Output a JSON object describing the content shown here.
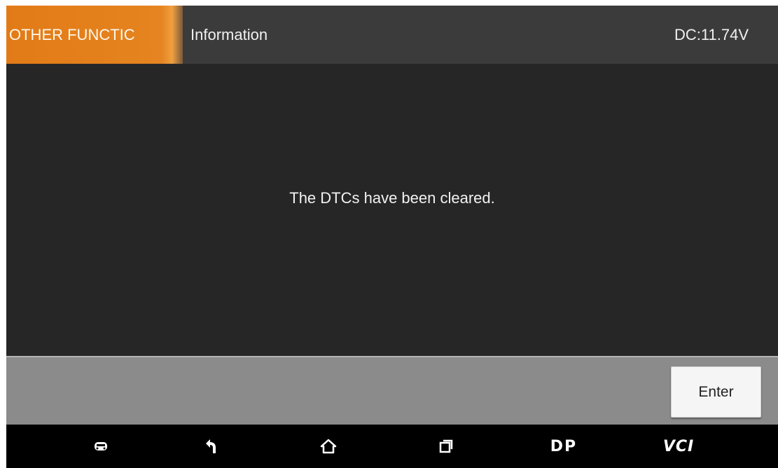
{
  "header": {
    "tab_label": "OTHER FUNCTIC",
    "title": "Information",
    "voltage": "DC:11.74V",
    "accent_color": "#e58420"
  },
  "main": {
    "message": "The DTCs have been cleared."
  },
  "actions": {
    "enter_label": "Enter"
  },
  "navbar": {
    "items": [
      {
        "icon": "vehicle-icon"
      },
      {
        "icon": "back-icon"
      },
      {
        "icon": "home-icon"
      },
      {
        "icon": "recent-apps-icon"
      },
      {
        "icon": "dp-icon",
        "label": "DP"
      },
      {
        "icon": "vci-icon",
        "label": "VCI"
      }
    ]
  }
}
